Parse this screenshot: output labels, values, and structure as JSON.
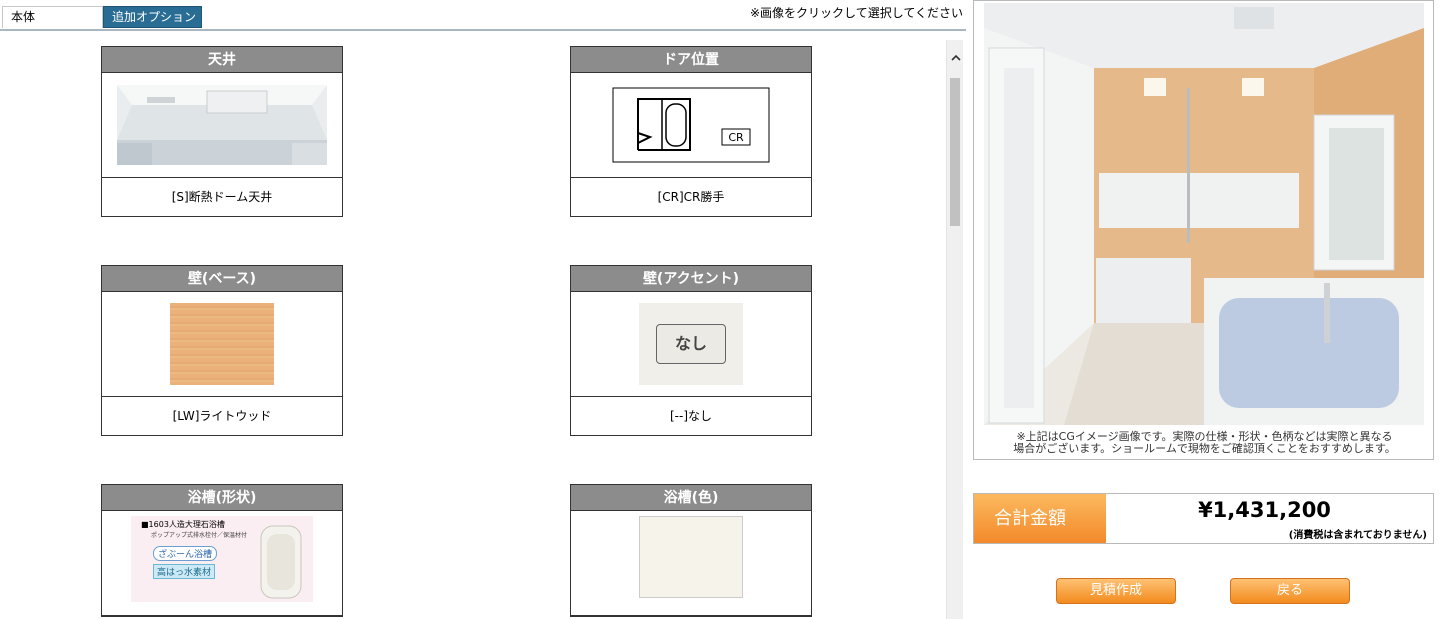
{
  "tabs": {
    "main": "本体",
    "options": "追加オプション"
  },
  "notice": "※画像をクリックして選択してください",
  "cards": {
    "ceiling": {
      "title": "天井",
      "caption": "[S]断熱ドーム天井"
    },
    "door": {
      "title": "ドア位置",
      "caption": "[CR]CR勝手",
      "diagram_label": "CR"
    },
    "wall_base": {
      "title": "壁(ベース)",
      "caption": "[LW]ライトウッド"
    },
    "wall_accent": {
      "title": "壁(アクセント)",
      "caption": "[--]なし",
      "swatch_label": "なし"
    },
    "tub_shape": {
      "title": "浴槽(形状)",
      "img_line1": "■1603人造大理石浴槽",
      "img_line2": "ポップアップ式排水栓付／保温材付",
      "img_tag1": "ざぶーん浴槽",
      "img_tag2": "高はっ水素材"
    },
    "tub_color": {
      "title": "浴槽(色)"
    }
  },
  "preview": {
    "note_line1": "※上記はCGイメージ画像です。実際の仕様・形状・色柄などは実際と異なる",
    "note_line2": "場合がございます。ショールームで現物をご確認頂くことをおすすめします。"
  },
  "total": {
    "label": "合計金額",
    "amount": "¥1,431,200",
    "tax_note": "(消費税は含まれておりません)"
  },
  "buttons": {
    "estimate": "見積作成",
    "back": "戻る"
  },
  "colors": {
    "tab_active": "#2a6d94",
    "card_header": "#8c8c8c",
    "accent_orange": "#f28b1e",
    "wood": "#eab27a"
  }
}
